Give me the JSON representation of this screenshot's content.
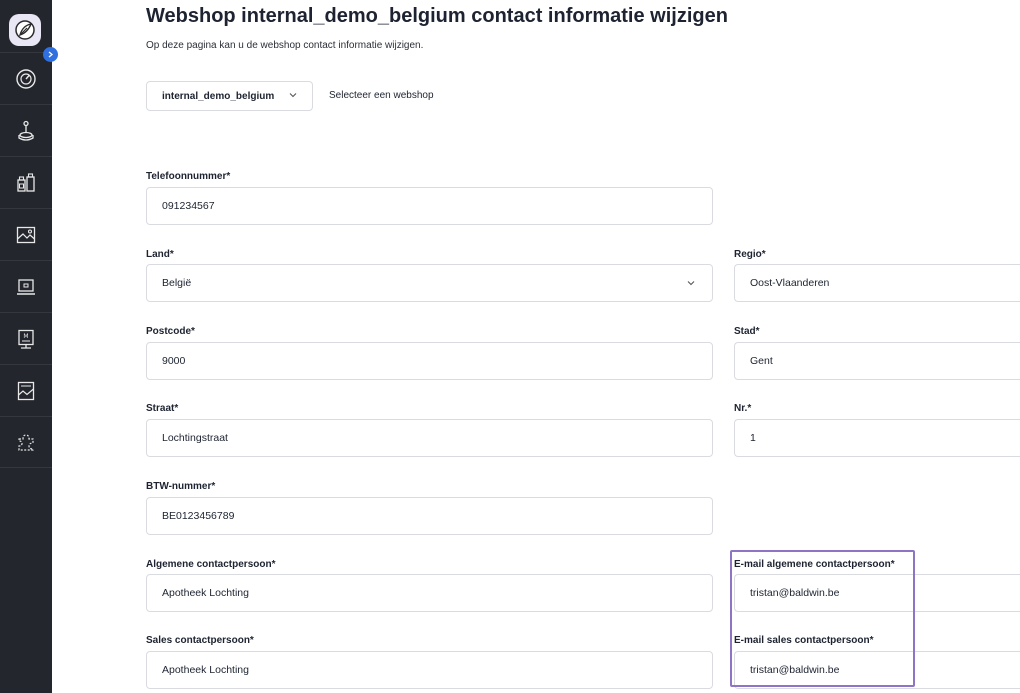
{
  "page": {
    "title": "Webshop internal_demo_belgium contact informatie wijzigen",
    "subtitle": "Op deze pagina kan u de webshop contact informatie wijzigen."
  },
  "webshop_select": {
    "value": "internal_demo_belgium",
    "label": "Selecteer een webshop"
  },
  "form": {
    "telefoon": {
      "label": "Telefoonnummer*",
      "value": "091234567"
    },
    "land": {
      "label": "Land*",
      "value": "België"
    },
    "regio": {
      "label": "Regio*",
      "value": "Oost-Vlaanderen"
    },
    "postcode": {
      "label": "Postcode*",
      "value": "9000"
    },
    "stad": {
      "label": "Stad*",
      "value": "Gent"
    },
    "straat": {
      "label": "Straat*",
      "value": "Lochtingstraat"
    },
    "nr": {
      "label": "Nr.*",
      "value": "1"
    },
    "btw": {
      "label": "BTW-nummer*",
      "value": "BE0123456789"
    },
    "algemene_contact": {
      "label": "Algemene contactpersoon*",
      "value": "Apotheek Lochting"
    },
    "email_algemene": {
      "label": "E-mail algemene contactpersoon*",
      "value": "tristan@baldwin.be"
    },
    "sales_contact": {
      "label": "Sales contactpersoon*",
      "value": "Apotheek Lochting"
    },
    "email_sales": {
      "label": "E-mail sales contactpersoon*",
      "value": "tristan@baldwin.be"
    }
  },
  "sidebar": {
    "icons": [
      "logo-icon",
      "dashboard-gauge-icon",
      "joystick-icon",
      "products-icon",
      "image-icon",
      "laptop-icon",
      "presentation-icon",
      "gallery-icon",
      "puzzle-icon"
    ]
  },
  "colors": {
    "sidebar_bg": "#23262c",
    "accent_blue": "#2f6fe0",
    "highlight_purple": "#8e74c4",
    "field_border": "#d9dbe0"
  }
}
